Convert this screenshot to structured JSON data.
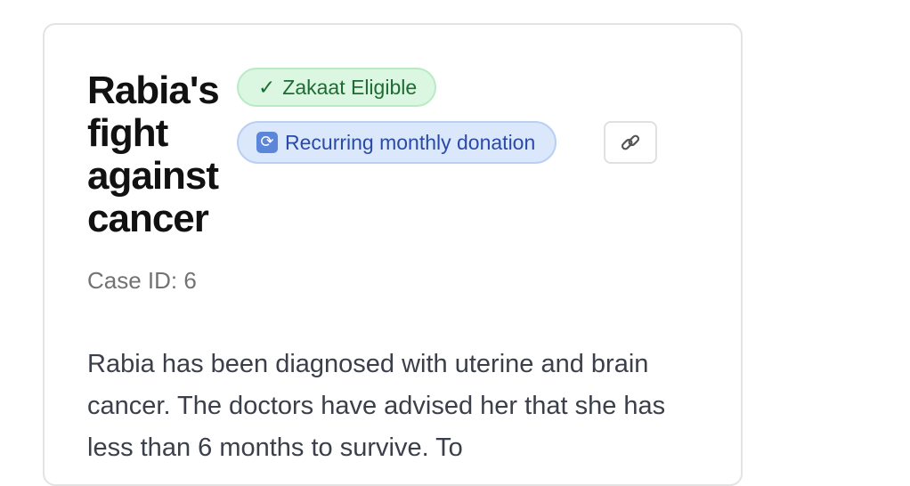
{
  "campaign": {
    "title": "Rabia's fight against cancer",
    "zakaat_badge": "Zakaat Eligible",
    "zakaat_check": "✓",
    "recurring_badge": "Recurring monthly donation",
    "case_id": "Case ID: 6",
    "description": "Rabia has been diagnosed with uterine and brain cancer. The doctors have advised her that she has less than 6 months to survive. To"
  },
  "icons": {
    "recurring": "repeat-icon",
    "share": "link-icon"
  },
  "colors": {
    "zakaat_bg": "#dcf7e1",
    "zakaat_text": "#1e6b33",
    "recurring_bg": "#dbe8fb",
    "recurring_text": "#2a4aa8"
  }
}
